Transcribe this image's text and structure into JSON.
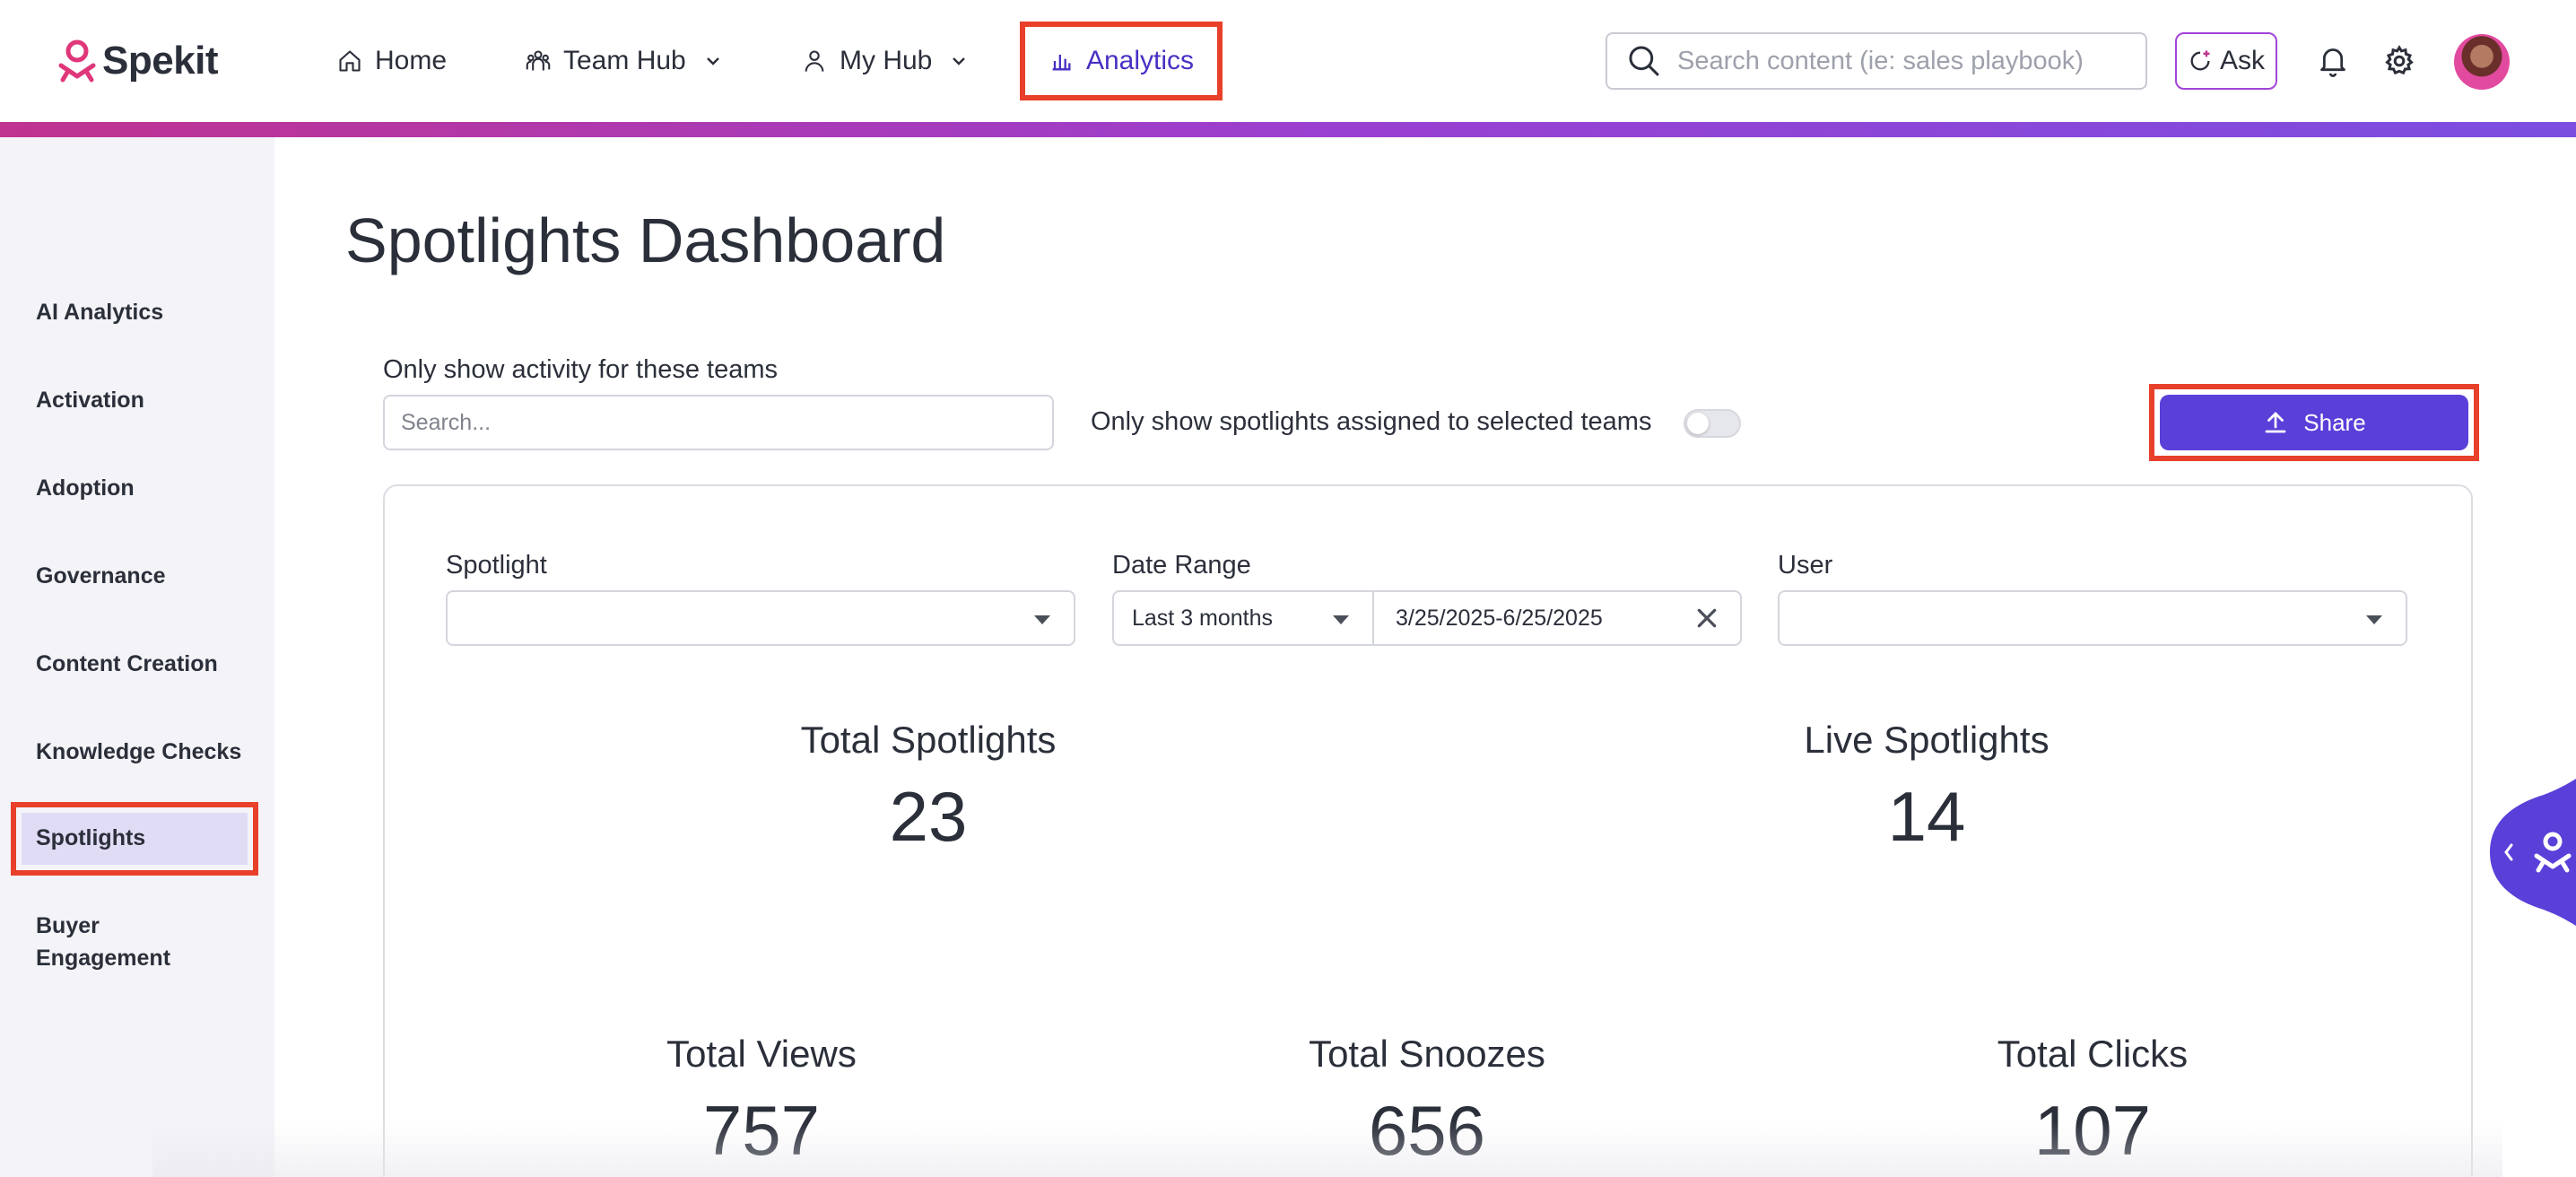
{
  "brand": {
    "name": "Spekit",
    "accent": "#5b3fd9",
    "logo_color": "#e0367a",
    "highlight": "#e8402b"
  },
  "nav": {
    "home": "Home",
    "team_hub": "Team Hub",
    "my_hub": "My Hub",
    "analytics": "Analytics"
  },
  "search": {
    "placeholder": "Search content (ie: sales playbook)"
  },
  "ask": {
    "label": "Ask"
  },
  "icons": {
    "home": "home-icon",
    "team": "team-icon",
    "user": "user-icon",
    "chart": "bar-chart-icon",
    "search": "search-icon",
    "ask": "spark-icon",
    "bell": "bell-icon",
    "gear": "gear-icon",
    "upload": "upload-icon",
    "clear": "close-icon"
  },
  "sidebar": {
    "items": [
      {
        "label": "AI Analytics"
      },
      {
        "label": "Activation"
      },
      {
        "label": "Adoption"
      },
      {
        "label": "Governance"
      },
      {
        "label": "Content Creation"
      },
      {
        "label": "Knowledge Checks"
      },
      {
        "label": "Spotlights",
        "active": true
      },
      {
        "label": "Buyer",
        "label2": "Engagement"
      }
    ]
  },
  "page": {
    "title": "Spotlights Dashboard",
    "team_filter_label": "Only show activity for these teams",
    "team_search_placeholder": "Search...",
    "toggle_label": "Only show spotlights assigned to selected teams",
    "toggle_on": false,
    "share_label": "Share"
  },
  "filters": {
    "spotlight_label": "Spotlight",
    "spotlight_value": "",
    "date_range_label": "Date Range",
    "date_range_preset": "Last 3 months",
    "date_range_value": "3/25/2025-6/25/2025",
    "user_label": "User",
    "user_value": ""
  },
  "metrics": {
    "total_spotlights": {
      "label": "Total Spotlights",
      "value": "23"
    },
    "live_spotlights": {
      "label": "Live Spotlights",
      "value": "14"
    },
    "total_views": {
      "label": "Total Views",
      "value": "757"
    },
    "total_snoozes": {
      "label": "Total Snoozes",
      "value": "656"
    },
    "total_clicks": {
      "label": "Total Clicks",
      "value": "107"
    }
  }
}
